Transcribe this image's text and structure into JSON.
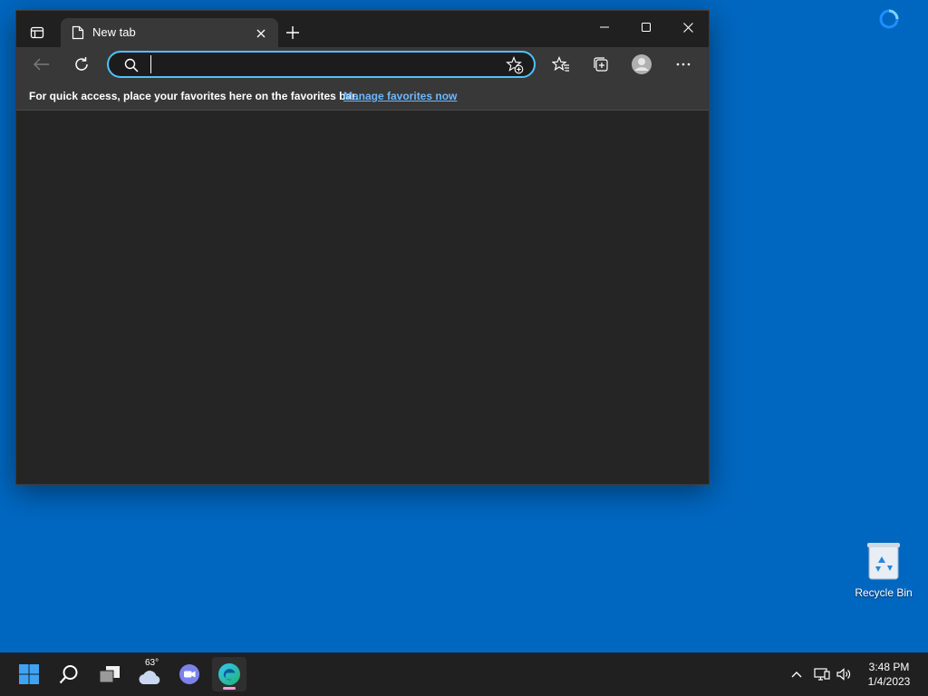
{
  "browser": {
    "tab": {
      "title": "New tab"
    },
    "address_bar": {
      "value": "",
      "placeholder": ""
    },
    "favorites_bar": {
      "message": "For quick access, place your favorites here on the favorites bar.",
      "link": "Manage favorites now"
    }
  },
  "desktop": {
    "icons": [
      {
        "label": "Recycle Bin",
        "icon": "recycle-bin-icon"
      }
    ]
  },
  "taskbar": {
    "weather_temp": "63°",
    "clock": {
      "time": "3:48 PM",
      "date": "1/4/2023"
    }
  },
  "colors": {
    "desktop": "#0067c0",
    "accent": "#4cc2ff",
    "link": "#6cb8ff",
    "taskbar": "#202020"
  }
}
